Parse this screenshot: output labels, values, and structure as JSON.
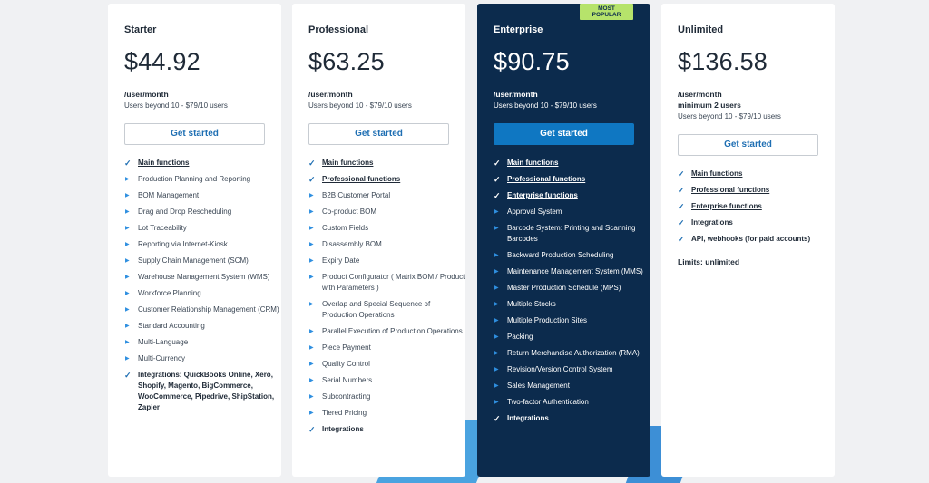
{
  "badge": {
    "line1": "MOST",
    "line2": "POPULAR"
  },
  "plans": [
    {
      "name": "Starter",
      "price": "$44.92",
      "per": "/user/month",
      "beyond": "Users beyond 10 - $79/10 users",
      "button": "Get started",
      "features": [
        {
          "text": "Main functions",
          "type": "check",
          "link": true
        },
        {
          "text": "Production Planning and Reporting",
          "type": "arrow"
        },
        {
          "text": "BOM Management",
          "type": "arrow"
        },
        {
          "text": "Drag and Drop Rescheduling",
          "type": "arrow"
        },
        {
          "text": "Lot Traceability",
          "type": "arrow"
        },
        {
          "text": "Reporting via Internet-Kiosk",
          "type": "arrow"
        },
        {
          "text": "Supply Chain Management (SCM)",
          "type": "arrow"
        },
        {
          "text": "Warehouse Management System (WMS)",
          "type": "arrow"
        },
        {
          "text": "Workforce Planning",
          "type": "arrow"
        },
        {
          "text": "Customer Relationship Management (CRM)",
          "type": "arrow"
        },
        {
          "text": "Standard Accounting",
          "type": "arrow"
        },
        {
          "text": "Multi-Language",
          "type": "arrow"
        },
        {
          "text": "Multi-Currency",
          "type": "arrow"
        },
        {
          "text": "Integrations: QuickBooks Online, Xero, Shopify, Magento, BigCommerce, WooCommerce, Pipedrive, ShipStation, Zapier",
          "type": "check"
        }
      ]
    },
    {
      "name": "Professional",
      "price": "$63.25",
      "per": "/user/month",
      "beyond": "Users beyond 10 - $79/10 users",
      "button": "Get started",
      "features": [
        {
          "text": "Main functions",
          "type": "check",
          "link": true
        },
        {
          "text": "Professional functions",
          "type": "check",
          "link": true
        },
        {
          "text": "B2B Customer Portal",
          "type": "arrow"
        },
        {
          "text": "Co-product BOM",
          "type": "arrow"
        },
        {
          "text": "Custom Fields",
          "type": "arrow"
        },
        {
          "text": "Disassembly BOM",
          "type": "arrow"
        },
        {
          "text": "Expiry Date",
          "type": "arrow"
        },
        {
          "text": "Product Configurator ( Matrix BOM / Product with Parameters )",
          "type": "arrow"
        },
        {
          "text": "Overlap and Special Sequence of Production Operations",
          "type": "arrow"
        },
        {
          "text": "Parallel Execution of Production Operations",
          "type": "arrow"
        },
        {
          "text": "Piece Payment",
          "type": "arrow"
        },
        {
          "text": "Quality Control",
          "type": "arrow"
        },
        {
          "text": "Serial Numbers",
          "type": "arrow"
        },
        {
          "text": "Subcontracting",
          "type": "arrow"
        },
        {
          "text": "Tiered Pricing",
          "type": "arrow"
        },
        {
          "text": "Integrations",
          "type": "check"
        }
      ]
    },
    {
      "name": "Enterprise",
      "price": "$90.75",
      "per": "/user/month",
      "beyond": "Users beyond 10 - $79/10 users",
      "button": "Get started",
      "features": [
        {
          "text": "Main functions",
          "type": "check",
          "link": true
        },
        {
          "text": "Professional functions",
          "type": "check",
          "link": true
        },
        {
          "text": "Enterprise functions",
          "type": "check",
          "link": true
        },
        {
          "text": "Approval System",
          "type": "arrow"
        },
        {
          "text": "Barcode System: Printing and Scanning Barcodes",
          "type": "arrow"
        },
        {
          "text": "Backward Production Scheduling",
          "type": "arrow"
        },
        {
          "text": "Maintenance Management System (MMS)",
          "type": "arrow"
        },
        {
          "text": "Master Production Schedule (MPS)",
          "type": "arrow"
        },
        {
          "text": "Multiple Stocks",
          "type": "arrow"
        },
        {
          "text": "Multiple Production Sites",
          "type": "arrow"
        },
        {
          "text": "Packing",
          "type": "arrow"
        },
        {
          "text": "Return Merchandise Authorization (RMA)",
          "type": "arrow"
        },
        {
          "text": "Revision/Version Control System",
          "type": "arrow"
        },
        {
          "text": "Sales Management",
          "type": "arrow"
        },
        {
          "text": "Two-factor Authentication",
          "type": "arrow"
        },
        {
          "text": "Integrations",
          "type": "check"
        }
      ]
    },
    {
      "name": "Unlimited",
      "price": "$136.58",
      "per": "/user/month",
      "min": "minimum 2 users",
      "beyond": "Users beyond 10 - $79/10 users",
      "button": "Get started",
      "features": [
        {
          "text": "Main functions",
          "type": "check",
          "link": true
        },
        {
          "text": "Professional functions",
          "type": "check",
          "link": true
        },
        {
          "text": "Enterprise functions",
          "type": "check",
          "link": true
        },
        {
          "text": "Integrations",
          "type": "check"
        },
        {
          "text": "API, webhooks (for paid accounts)",
          "type": "check"
        }
      ],
      "limits_label": "Limits:",
      "limits_value": "unlimited"
    }
  ],
  "icons": {
    "check": "check-icon",
    "arrow": "arrow-right-icon"
  },
  "colors": {
    "accent": "#1f6fb3",
    "dark_card": "#0c2b4d",
    "badge": "#b6e36b",
    "arrow": "#2f8fe0"
  }
}
